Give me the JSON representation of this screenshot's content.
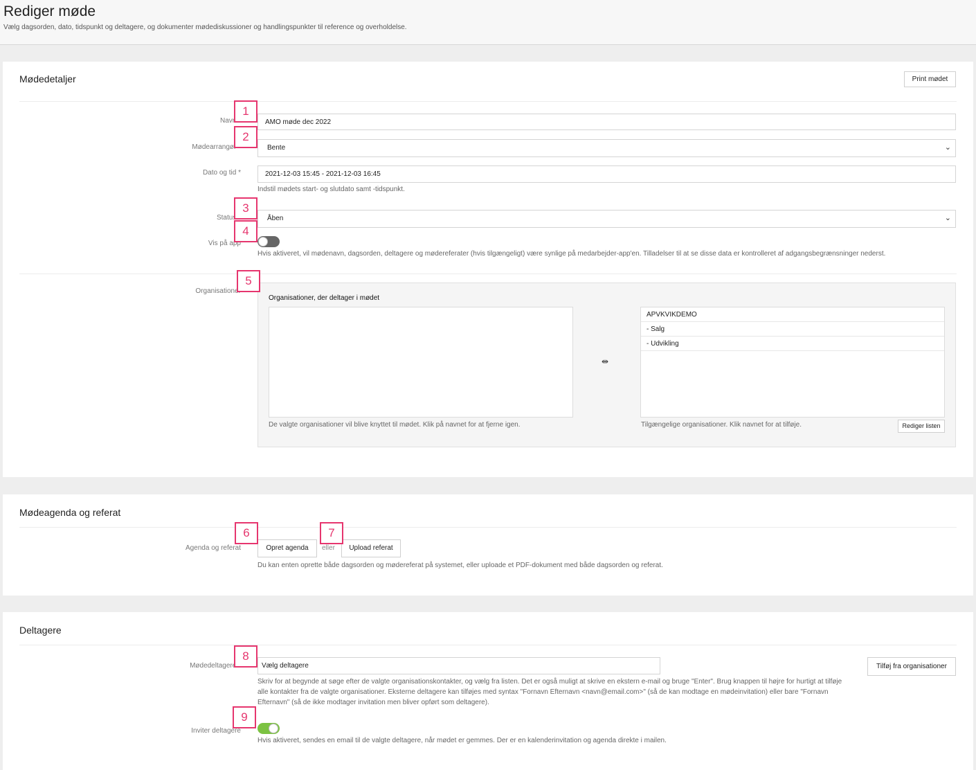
{
  "header": {
    "title": "Rediger møde",
    "subtitle": "Vælg dagsorden, dato, tidspunkt og deltagere, og dokumenter mødediskussioner og handlingspunkter til reference og overholdelse."
  },
  "details": {
    "title": "Mødedetaljer",
    "print_label": "Print mødet",
    "name_label": "Navn *",
    "name_value": "AMO møde dec 2022",
    "organizer_label": "Mødearrangør *",
    "organizer_value": "Bente",
    "date_label": "Dato og tid *",
    "date_value": "2021-12-03 15:45 - 2021-12-03 16:45",
    "date_help": "Indstil mødets start- og slutdato samt -tidspunkt.",
    "status_label": "Status *",
    "status_value": "Åben",
    "app_label": "Vis på app",
    "app_help": "Hvis aktiveret, vil mødenavn, dagsorden, deltagere og mødereferater (hvis tilgængeligt) være synlige på medarbejder-app'en. Tilladelser til at se disse data er kontrolleret af adgangsbegrænsninger nederst.",
    "org_label": "Organisationer",
    "org_panel_title": "Organisationer, der deltager i mødet",
    "transfer_icon": "⇹",
    "available_orgs": [
      "APVKVIKDEMO",
      "- Salg",
      "- Udvikling"
    ],
    "selected_help": "De valgte organisationer vil blive knyttet til mødet. Klik på navnet for at fjerne igen.",
    "available_help": "Tilgængelige organisationer. Klik navnet for at tilføje.",
    "edit_list_label": "Rediger listen"
  },
  "agenda": {
    "title": "Mødeagenda og referat",
    "label": "Agenda og referat",
    "create_label": "Opret agenda",
    "or_label": "eller",
    "upload_label": "Upload referat",
    "help": "Du kan enten oprette både dagsorden og mødereferat på systemet, eller uploade et PDF-dokument med både dagsorden og referat."
  },
  "participants": {
    "title": "Deltagere",
    "label": "Mødedeltagere *",
    "placeholder": "Vælg deltagere",
    "add_from_org_label": "Tilføj fra organisationer",
    "help": "Skriv for at begynde at søge efter de valgte organisationskontakter, og vælg fra listen. Det er også muligt at skrive en ekstern e-mail og bruge \"Enter\". Brug knappen til højre for hurtigt at tilføje alle kontakter fra de valgte organisationer. Eksterne deltagere kan tilføjes med syntax \"Fornavn Efternavn <navn@email.com>\" (så de kan modtage en mødeinvitation) eller bare \"Fornavn Efternavn\" (så de ikke modtager invitation men bliver opført som deltagere).",
    "invite_label": "Inviter deltagere",
    "invite_help": "Hvis aktiveret, sendes en email til de valgte deltagere, når mødet er gemmes. Der er en kalenderinvitation og agenda direkte i mailen."
  },
  "toggles": {
    "show_on_app": false,
    "invite_participants": true
  },
  "colors": {
    "toggle_on": "#7cc242",
    "toggle_off": "#666666",
    "marker": "#e6356e"
  },
  "markers": [
    "1",
    "2",
    "3",
    "4",
    "5",
    "6",
    "7",
    "8",
    "9"
  ]
}
